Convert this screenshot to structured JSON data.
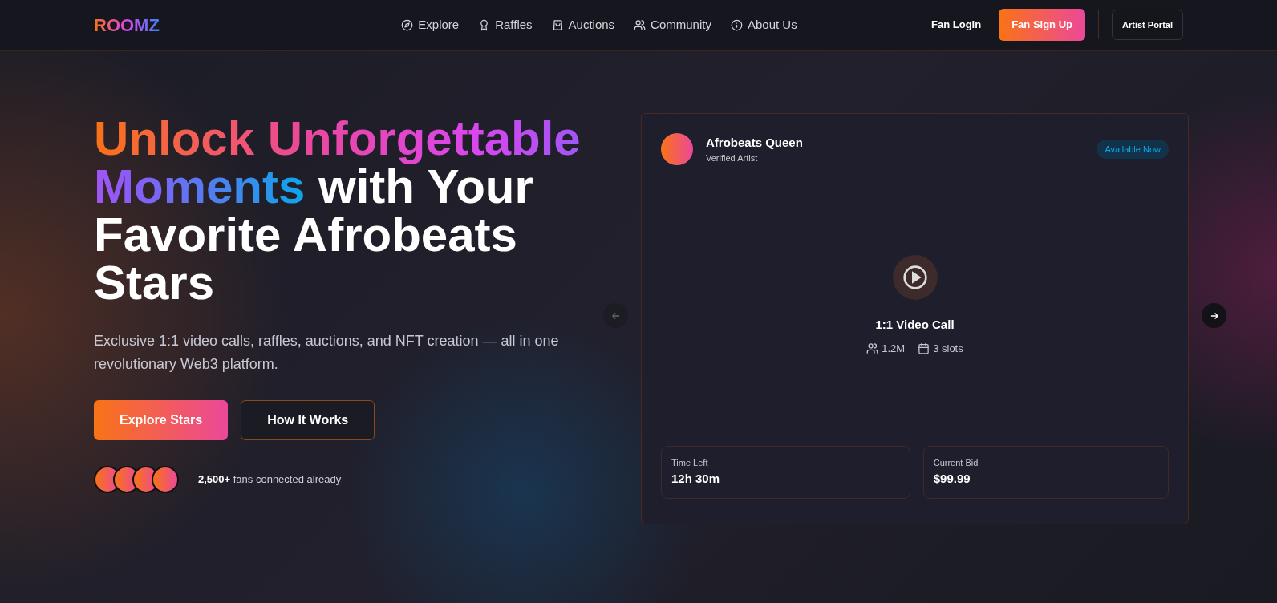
{
  "brand": "ROOMZ",
  "nav": [
    {
      "label": "Explore"
    },
    {
      "label": "Raffles"
    },
    {
      "label": "Auctions"
    },
    {
      "label": "Community"
    },
    {
      "label": "About Us"
    }
  ],
  "actions": {
    "login": "Fan Login",
    "signup": "Fan Sign Up",
    "portal": "Artist Portal"
  },
  "hero": {
    "headline_highlight": "Unlock Unforgettable Moments",
    "headline_rest": "with Your Favorite Afrobeats Stars",
    "subtitle": "Exclusive 1:1 video calls, raffles, auctions, and NFT creation — all in one revolutionary Web3 platform.",
    "buttons": [
      "Explore Stars",
      "How It Works"
    ],
    "fans_count": "2,500+",
    "fans_text": "fans connected already"
  },
  "card": {
    "artist": "Afrobeats Queen",
    "subtitle": "Verified Artist",
    "badge": "Available Now",
    "title": "1:1 Video Call",
    "stats": [
      "1.2M",
      "3 slots"
    ],
    "boxes": [
      {
        "label": "Time Left",
        "value": "12h 30m"
      },
      {
        "label": "Current Bid",
        "value": "$99.99"
      }
    ],
    "prev_disabled": true,
    "next_disabled": false
  }
}
